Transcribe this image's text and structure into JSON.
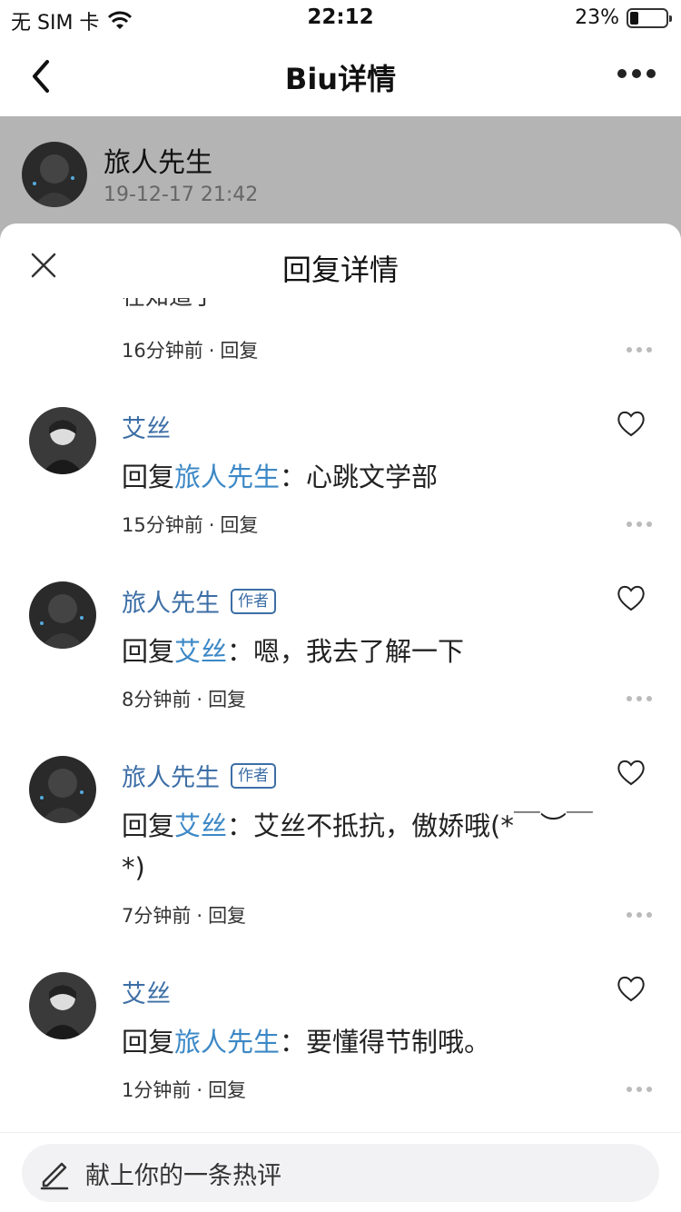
{
  "status_bar": {
    "carrier": "无 SIM 卡",
    "time": "22:12",
    "battery_percent_text": "23%",
    "battery_level": 0.23
  },
  "nav": {
    "title": "Biu详情",
    "back_icon": "chevron-left-icon",
    "more_icon": "more-horizontal-icon"
  },
  "post": {
    "author": "旅人先生",
    "timestamp": "19-12-17 21:42"
  },
  "sheet": {
    "title": "回复详情",
    "close_icon": "close-icon",
    "partial_item": {
      "text": "在知道了",
      "time": "16分钟前",
      "reply_label": "回复"
    },
    "comments": [
      {
        "author": "艾丝",
        "is_author": false,
        "reply_prefix": "回复",
        "reply_to": "旅人先生",
        "colon": "：",
        "body": "心跳文学部",
        "time": "15分钟前",
        "reply_label": "回复"
      },
      {
        "author": "旅人先生",
        "is_author": true,
        "badge": "作者",
        "reply_prefix": "回复",
        "reply_to": "艾丝",
        "colon": "：",
        "body": "嗯，我去了解一下",
        "time": "8分钟前",
        "reply_label": "回复"
      },
      {
        "author": "旅人先生",
        "is_author": true,
        "badge": "作者",
        "reply_prefix": "回复",
        "reply_to": "艾丝",
        "colon": "：",
        "body": "艾丝不抵抗，傲娇哦(*￣︶￣*)",
        "time": "7分钟前",
        "reply_label": "回复"
      },
      {
        "author": "艾丝",
        "is_author": false,
        "reply_prefix": "回复",
        "reply_to": "旅人先生",
        "colon": "：",
        "body": "要懂得节制哦。",
        "time": "1分钟前",
        "reply_label": "回复"
      }
    ]
  },
  "composer": {
    "placeholder": "献上你的一条热评",
    "icon": "pencil-icon"
  },
  "colors": {
    "accent_name": "#3c6ea6",
    "accent_mention": "#3c88c6",
    "dim_overlay": "#b4b4b4"
  }
}
